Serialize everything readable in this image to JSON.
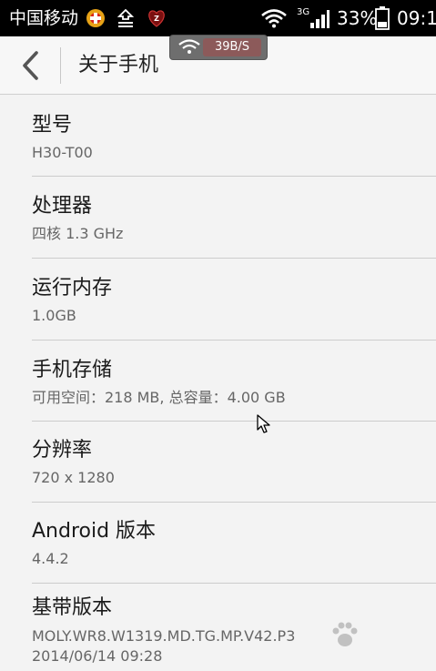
{
  "status_bar": {
    "carrier": "中国移动",
    "network_type": "3G",
    "battery": "33%",
    "time": "09:1"
  },
  "speed_indicator": {
    "value": "39B/S"
  },
  "action_bar": {
    "title": "关于手机"
  },
  "items": [
    {
      "label": "型号",
      "value": "H30-T00"
    },
    {
      "label": "处理器",
      "value": "四核 1.3 GHz"
    },
    {
      "label": "运行内存",
      "value": "1.0GB"
    },
    {
      "label": "手机存储",
      "value": "可用空间：218 MB, 总容量：4.00 GB"
    },
    {
      "label": "分辨率",
      "value": "720 x 1280"
    },
    {
      "label": "Android 版本",
      "value": "4.4.2"
    },
    {
      "label": "基带版本",
      "value": "MOLY.WR8.W1319.MD.TG.MP.V42.P3",
      "value2": "2014/06/14 09:28"
    }
  ],
  "colors": {
    "background": "#f3f3f3",
    "status_bar": "#000000",
    "divider": "#cccccc"
  }
}
